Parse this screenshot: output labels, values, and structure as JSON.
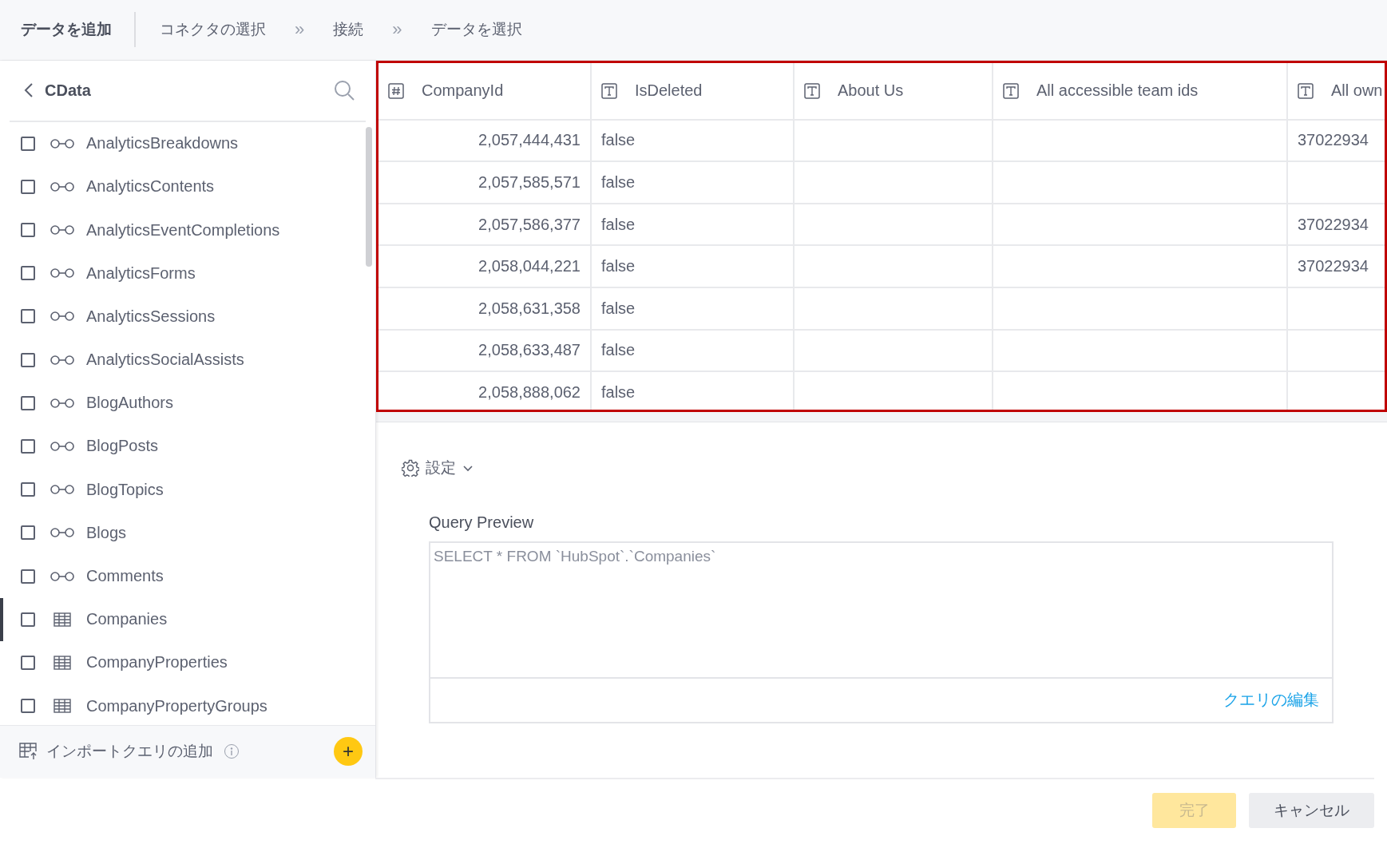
{
  "header": {
    "title": "データを追加",
    "steps": [
      {
        "label": "コネクタの選択",
        "selected": false
      },
      {
        "label": "接続",
        "selected": false
      },
      {
        "label": "データを選択",
        "selected": false
      }
    ],
    "separators": [
      "»",
      "»"
    ]
  },
  "sidebar": {
    "title": "CData",
    "items": [
      {
        "label": "AnalyticsBreakdowns",
        "kind": "view",
        "checked": false,
        "selected": false
      },
      {
        "label": "AnalyticsContents",
        "kind": "view",
        "checked": false,
        "selected": false
      },
      {
        "label": "AnalyticsEventCompletions",
        "kind": "view",
        "checked": false,
        "selected": false
      },
      {
        "label": "AnalyticsForms",
        "kind": "view",
        "checked": false,
        "selected": false
      },
      {
        "label": "AnalyticsSessions",
        "kind": "view",
        "checked": false,
        "selected": false
      },
      {
        "label": "AnalyticsSocialAssists",
        "kind": "view",
        "checked": false,
        "selected": false
      },
      {
        "label": "BlogAuthors",
        "kind": "view",
        "checked": false,
        "selected": false
      },
      {
        "label": "BlogPosts",
        "kind": "view",
        "checked": false,
        "selected": false
      },
      {
        "label": "BlogTopics",
        "kind": "view",
        "checked": false,
        "selected": false
      },
      {
        "label": "Blogs",
        "kind": "view",
        "checked": false,
        "selected": false
      },
      {
        "label": "Comments",
        "kind": "view",
        "checked": false,
        "selected": false
      },
      {
        "label": "Companies",
        "kind": "table",
        "checked": false,
        "selected": true
      },
      {
        "label": "CompanyProperties",
        "kind": "table",
        "checked": false,
        "selected": false
      },
      {
        "label": "CompanyPropertyGroups",
        "kind": "table",
        "checked": false,
        "selected": false
      }
    ],
    "footer": {
      "label": "インポートクエリの追加",
      "add_button": "+"
    }
  },
  "table": {
    "columns": [
      {
        "label": "CompanyId",
        "kind": "number"
      },
      {
        "label": "IsDeleted",
        "kind": "text"
      },
      {
        "label": "About Us",
        "kind": "text"
      },
      {
        "label": "All accessible team ids",
        "kind": "text"
      },
      {
        "label": "All own",
        "kind": "text"
      }
    ],
    "rows": [
      {
        "company_id": "2,057,444,431",
        "is_deleted": "false",
        "column_5": "37022934"
      },
      {
        "company_id": "2,057,585,571",
        "is_deleted": "false"
      },
      {
        "company_id": "2,057,586,377",
        "is_deleted": "false",
        "column_5": "37022934"
      },
      {
        "company_id": "2,058,044,221",
        "is_deleted": "false",
        "column_5": "37022934"
      },
      {
        "company_id": "2,058,631,358",
        "is_deleted": "false"
      },
      {
        "company_id": "2,058,633,487",
        "is_deleted": "false"
      },
      {
        "company_id": "2,058,888,062",
        "is_deleted": "false"
      }
    ]
  },
  "settings": {
    "label": "設定",
    "expanded": false
  },
  "query_preview": {
    "label": "Query Preview",
    "value": "SELECT * FROM `HubSpot`.`Companies`",
    "edit_link": "クエリの編集"
  },
  "buttons": [
    {
      "label": "完了",
      "kind": "primary",
      "disabled": true
    },
    {
      "label": "キャンセル",
      "kind": "secondary",
      "disabled": false
    }
  ]
}
